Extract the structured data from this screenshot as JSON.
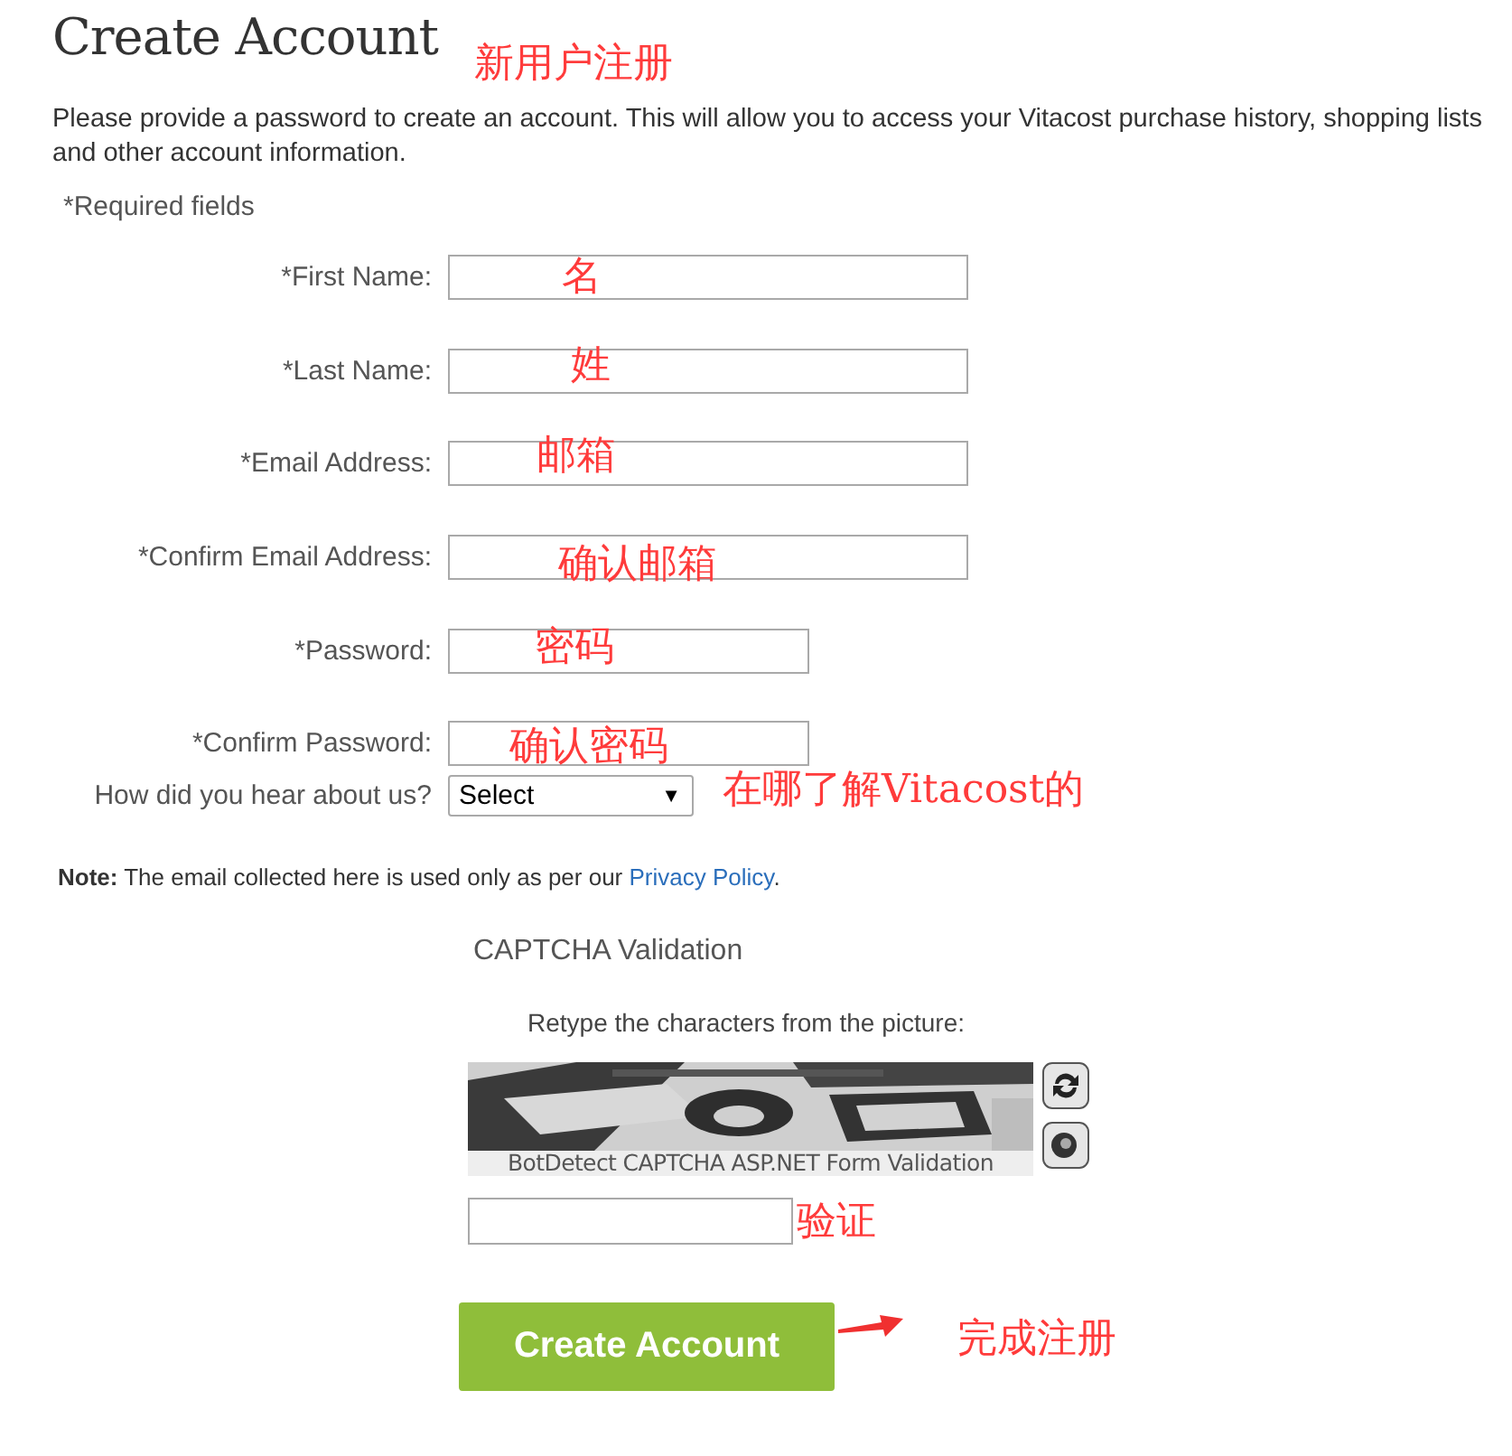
{
  "title": "Create Account",
  "title_annotation": "新用户注册",
  "intro": "Please provide a password to create an account. This will allow you to access your Vitacost purchase history, shopping lists and other account information.",
  "required_note": "*Required fields",
  "fields": [
    {
      "label": "*First Name:",
      "kind": "text",
      "annotation": "名"
    },
    {
      "label": "*Last Name:",
      "kind": "text",
      "annotation": "姓"
    },
    {
      "label": "*Email Address:",
      "kind": "text",
      "annotation": "邮箱"
    },
    {
      "label": "*Confirm Email Address:",
      "kind": "text",
      "annotation": "确认邮箱"
    },
    {
      "label": "*Password:",
      "kind": "password",
      "annotation": "密码"
    },
    {
      "label": "*Confirm Password:",
      "kind": "password",
      "annotation": "确认密码"
    }
  ],
  "hear_about": {
    "label": "How did you hear about us?",
    "value": "Select",
    "caret": "▼",
    "annotation": "在哪了解Vitacost的"
  },
  "note": {
    "text": "**Note:** The email collected here is used only as per our",
    "link": "Privacy Policy",
    "end": "."
  },
  "captcha": {
    "heading": "CAPTCHA Validation",
    "instruction": "Retype the characters from the picture:",
    "caption": "BotDetect CAPTCHA ASP.NET Form Validation",
    "annotation": "验证"
  },
  "submit": {
    "label": "Create Account",
    "annotation": "完成注册"
  }
}
